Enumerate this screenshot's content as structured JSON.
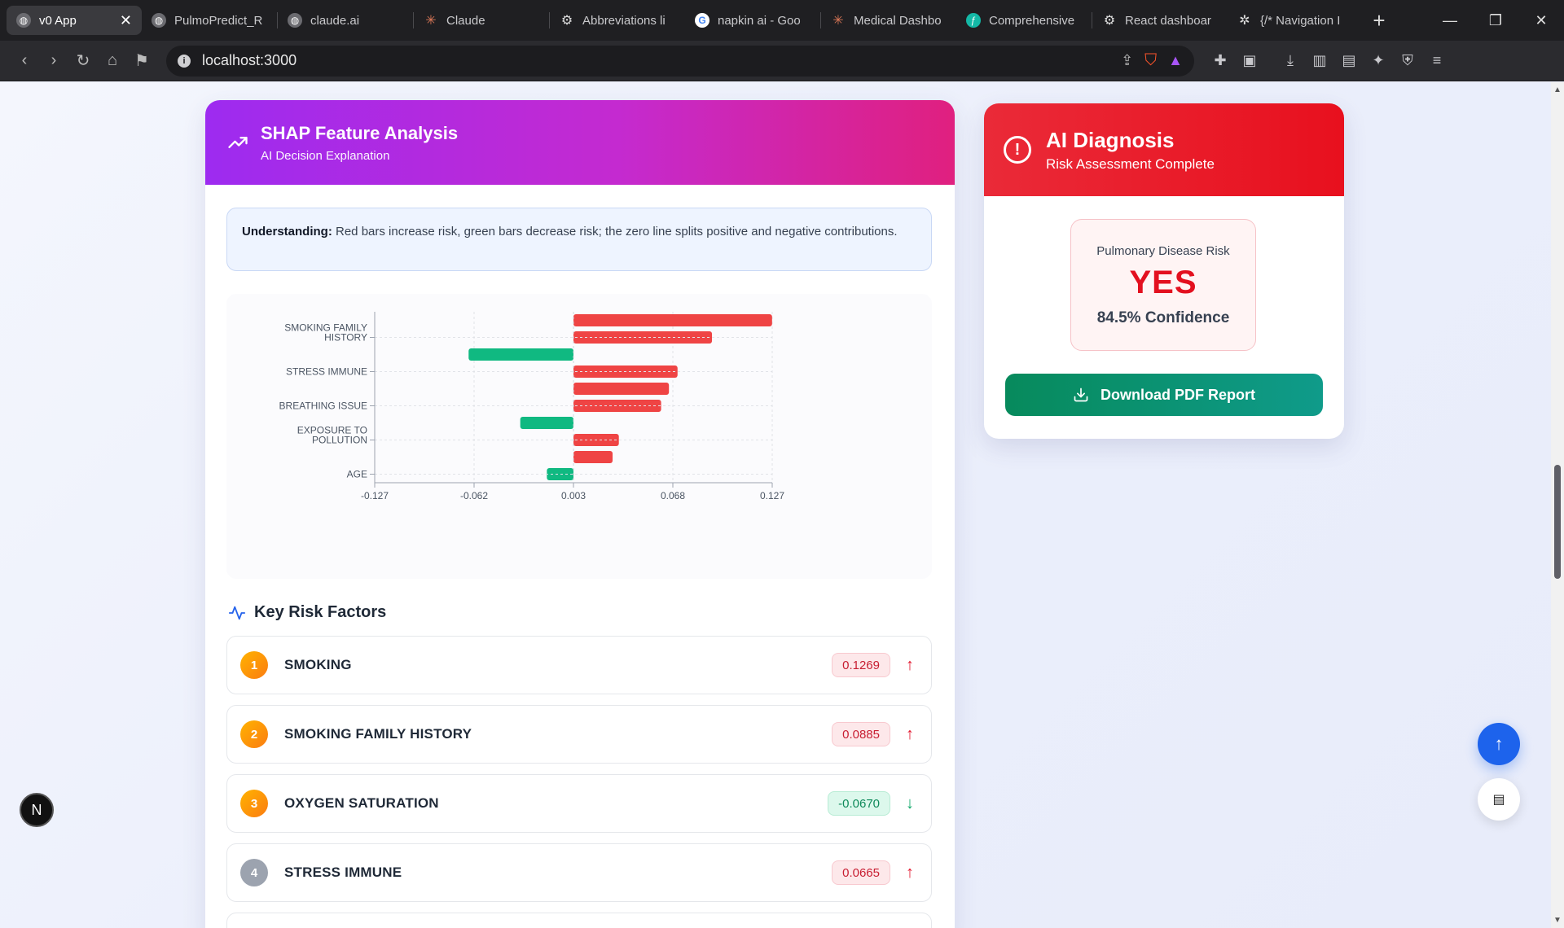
{
  "browser": {
    "tabs": [
      {
        "label": "v0 App",
        "icon": "globe-icon",
        "active": true
      },
      {
        "label": "PulmoPredict_R",
        "icon": "globe-icon"
      },
      {
        "label": "claude.ai",
        "icon": "globe-icon"
      },
      {
        "label": "Claude",
        "icon": "claude-icon"
      },
      {
        "label": "Abbreviations li",
        "icon": "openai-icon"
      },
      {
        "label": "napkin ai - Goo",
        "icon": "google-icon"
      },
      {
        "label": "Medical Dashbo",
        "icon": "claude-icon"
      },
      {
        "label": "Comprehensive",
        "icon": "feather-icon"
      },
      {
        "label": "React dashboar",
        "icon": "openai-icon"
      },
      {
        "label": "{/* Navigation I",
        "icon": "gear-icon"
      }
    ],
    "url": "localhost:3000"
  },
  "shap": {
    "title": "SHAP Feature Analysis",
    "subtitle": "AI Decision Explanation",
    "info_bold": "Understanding:",
    "info_text": " Red bars increase risk, green bars decrease risk; the zero line splits positive and negative contributions."
  },
  "chart_data": {
    "type": "bar",
    "orientation": "horizontal",
    "y_tick_labels": [
      "SMOKING FAMILY HISTORY",
      "STRESS IMMUNE",
      "BREATHING ISSUE",
      "EXPOSURE TO POLLUTION",
      "AGE"
    ],
    "x_tick_labels": [
      "-0.127",
      "-0.062",
      "0.003",
      "0.068",
      "0.127"
    ],
    "xlim": [
      -0.127,
      0.127
    ],
    "grid": true,
    "bars": [
      {
        "value": 0.1269,
        "color": "#ef4444"
      },
      {
        "value": 0.0885,
        "color": "#ef4444"
      },
      {
        "value": -0.067,
        "color": "#10b981"
      },
      {
        "value": 0.0665,
        "color": "#ef4444"
      },
      {
        "value": 0.061,
        "color": "#ef4444"
      },
      {
        "value": 0.056,
        "color": "#ef4444"
      },
      {
        "value": -0.034,
        "color": "#10b981"
      },
      {
        "value": 0.029,
        "color": "#ef4444"
      },
      {
        "value": 0.025,
        "color": "#ef4444"
      },
      {
        "value": -0.017,
        "color": "#10b981"
      }
    ]
  },
  "risk_factors": {
    "title": "Key Risk Factors",
    "items": [
      {
        "rank": "1",
        "name": "SMOKING",
        "value": "0.1269",
        "direction": "up"
      },
      {
        "rank": "2",
        "name": "SMOKING FAMILY HISTORY",
        "value": "0.0885",
        "direction": "up"
      },
      {
        "rank": "3",
        "name": "OXYGEN SATURATION",
        "value": "-0.0670",
        "direction": "down"
      },
      {
        "rank": "4",
        "name": "STRESS IMMUNE",
        "value": "0.0665",
        "direction": "up"
      }
    ]
  },
  "diagnosis": {
    "title": "AI Diagnosis",
    "subtitle": "Risk Assessment Complete",
    "risk_label": "Pulmonary Disease Risk",
    "risk_value": "YES",
    "confidence": "84.5% Confidence",
    "download_label": "Download PDF Report"
  },
  "badge": "N",
  "colors": {
    "shap_gradient": [
      "#9d2bf0",
      "#e0207f"
    ],
    "diag_red": "#e8101e",
    "positive": "#ef4444",
    "negative": "#10b981",
    "download_green": "#078a5c",
    "scroll_top_blue": "#1d63ec"
  }
}
